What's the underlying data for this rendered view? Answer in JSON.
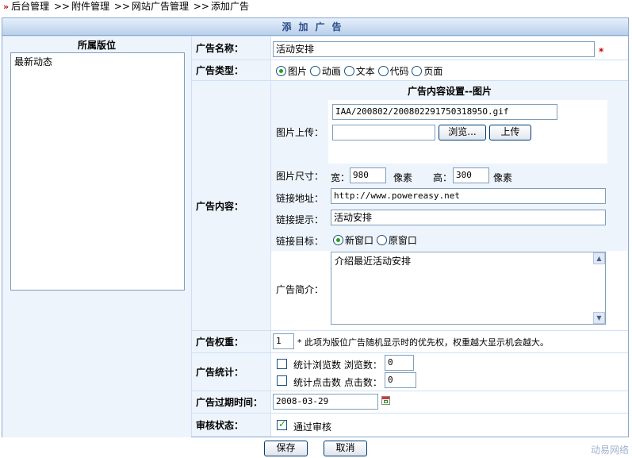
{
  "breadcrumb": [
    "后台管理",
    "附件管理",
    "网站广告管理",
    "添加广告"
  ],
  "breadcrumb_sep": ">>",
  "form_title": "添加广告",
  "slot_panel": {
    "header": "所属版位",
    "items": [
      "最新动态"
    ]
  },
  "fields": {
    "name_label": "广告名称：",
    "name_value": "活动安排",
    "required_mark": "*",
    "type_label": "广告类型：",
    "type_options": [
      "图片",
      "动画",
      "文本",
      "代码",
      "页面"
    ],
    "type_selected": "图片",
    "content_label": "广告内容：",
    "content_header": "广告内容设置--图片",
    "upload_label": "图片上传：",
    "image_path": "IAA/200802/20080229175031895O.gif",
    "browse_button": "浏览...",
    "upload_button": "上传",
    "size_label": "图片尺寸：",
    "width_label": "宽：",
    "width_value": "980",
    "height_label": "高：",
    "height_value": "300",
    "unit_px": "像素",
    "link_label": "链接地址：",
    "link_value": "http://www.powereasy.net",
    "tip_label": "链接提示：",
    "tip_value": "活动安排",
    "target_label": "链接目标：",
    "target_options": [
      "新窗口",
      "原窗口"
    ],
    "target_selected": "新窗口",
    "intro_label": "广告简介：",
    "intro_value": "介绍最近活动安排",
    "weight_label": "广告权重：",
    "weight_value": "1",
    "weight_hint": "* 此项为版位广告随机显示时的优先权，权重越大显示机会越大。",
    "stats_label": "广告统计：",
    "stat_views_label": "统计浏览数 浏览数：",
    "stat_views_value": "0",
    "stat_clicks_label": "统计点击数 点击数：",
    "stat_clicks_value": "0",
    "expire_label": "广告过期时间：",
    "expire_value": "2008-03-29",
    "audit_label": "审核状态：",
    "audit_option": "通过审核"
  },
  "buttons": {
    "save": "保存",
    "cancel": "取消"
  },
  "watermark": "动易网络",
  "colors": {
    "frame": "#8aa8d0",
    "label_bg": "#eef4fc",
    "title_text": "#2b4d8c",
    "required": "#cc0000",
    "check": "#21a121"
  }
}
